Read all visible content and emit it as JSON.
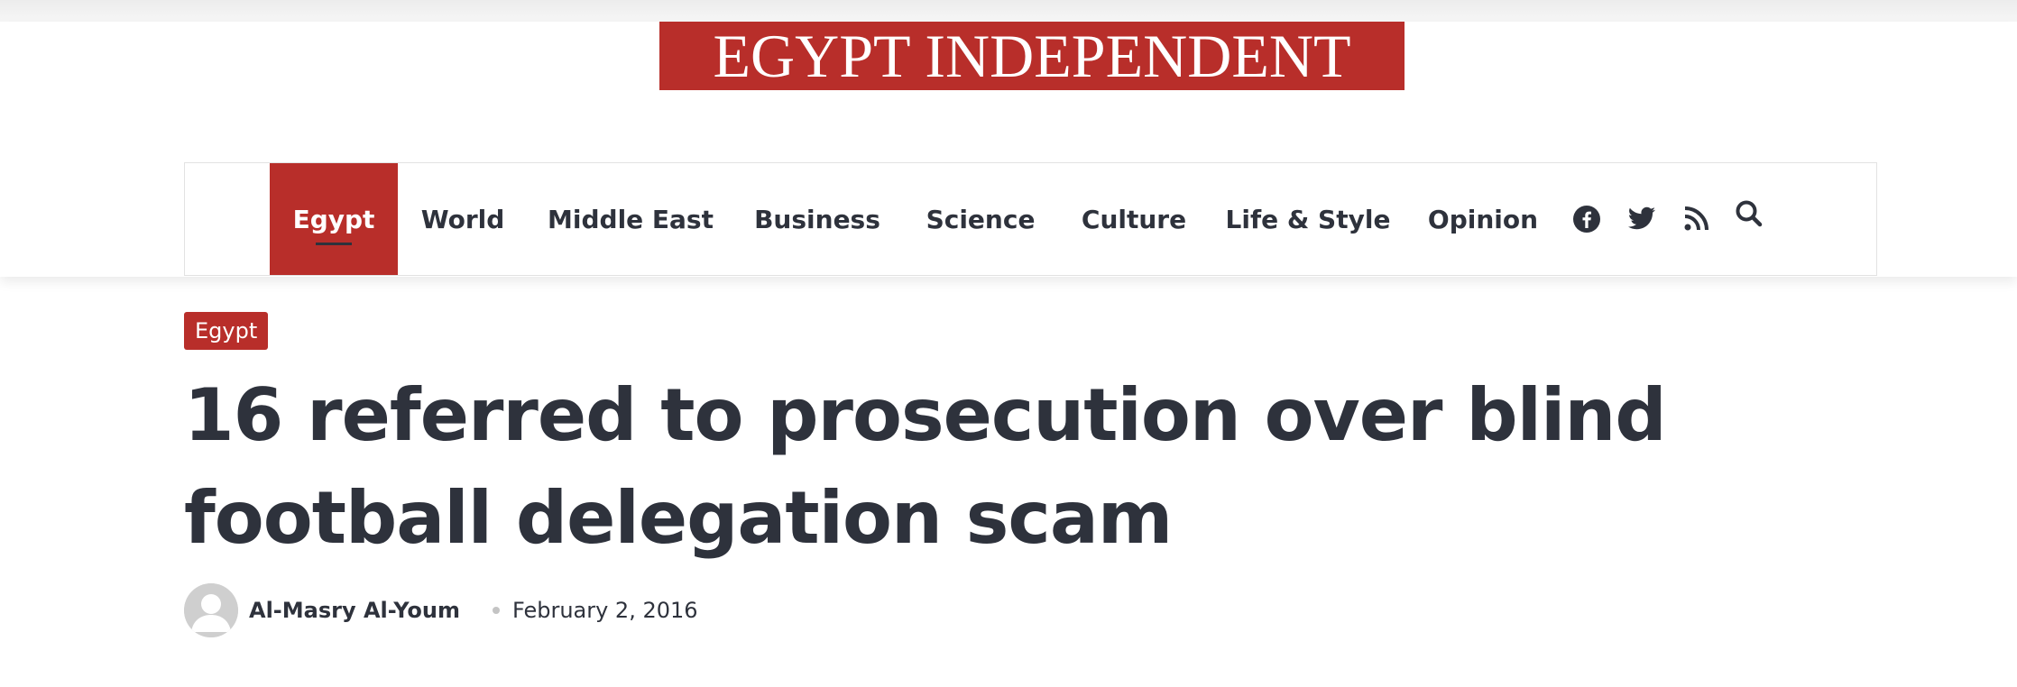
{
  "site": {
    "logo_text": "EGYPT INDEPENDENT"
  },
  "nav": {
    "items": [
      {
        "label": "Egypt",
        "active": true
      },
      {
        "label": "World"
      },
      {
        "label": "Middle East"
      },
      {
        "label": "Business"
      },
      {
        "label": "Science"
      },
      {
        "label": "Culture"
      },
      {
        "label": "Life & Style"
      },
      {
        "label": "Opinion"
      }
    ],
    "icons": [
      "facebook-icon",
      "twitter-icon",
      "rss-icon",
      "search-icon"
    ]
  },
  "article": {
    "category": "Egypt",
    "title": "16 referred to prosecution over blind football delegation scam",
    "author": "Al-Masry Al-Youm",
    "date": "February 2, 2016"
  },
  "colors": {
    "brand_red": "#b82e2a",
    "text_dark": "#2e323c"
  }
}
